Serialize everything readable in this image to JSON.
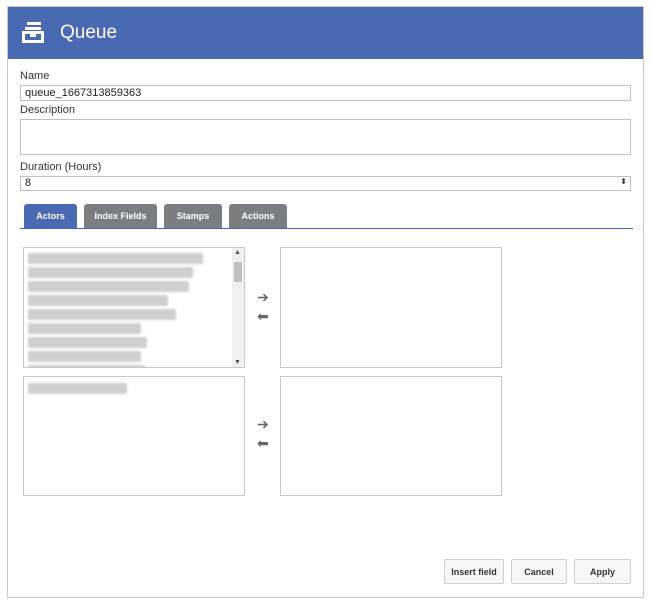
{
  "header": {
    "title": "Queue",
    "icon": "inbox-tray-icon"
  },
  "form": {
    "name_label": "Name",
    "name_value": "queue_1667313859363",
    "description_label": "Description",
    "description_value": "",
    "duration_label": "Duration (Hours)",
    "duration_value": "8"
  },
  "tabs": [
    {
      "label": "Actors",
      "active": true
    },
    {
      "label": "Index Fields",
      "active": false
    },
    {
      "label": "Stamps",
      "active": false
    },
    {
      "label": "Actions",
      "active": false
    }
  ],
  "buttons": {
    "insert_field": "Insert field",
    "cancel": "Cancel",
    "apply": "Apply"
  },
  "colors": {
    "accent": "#4a69b3",
    "tab_inactive": "#7b7d80"
  }
}
